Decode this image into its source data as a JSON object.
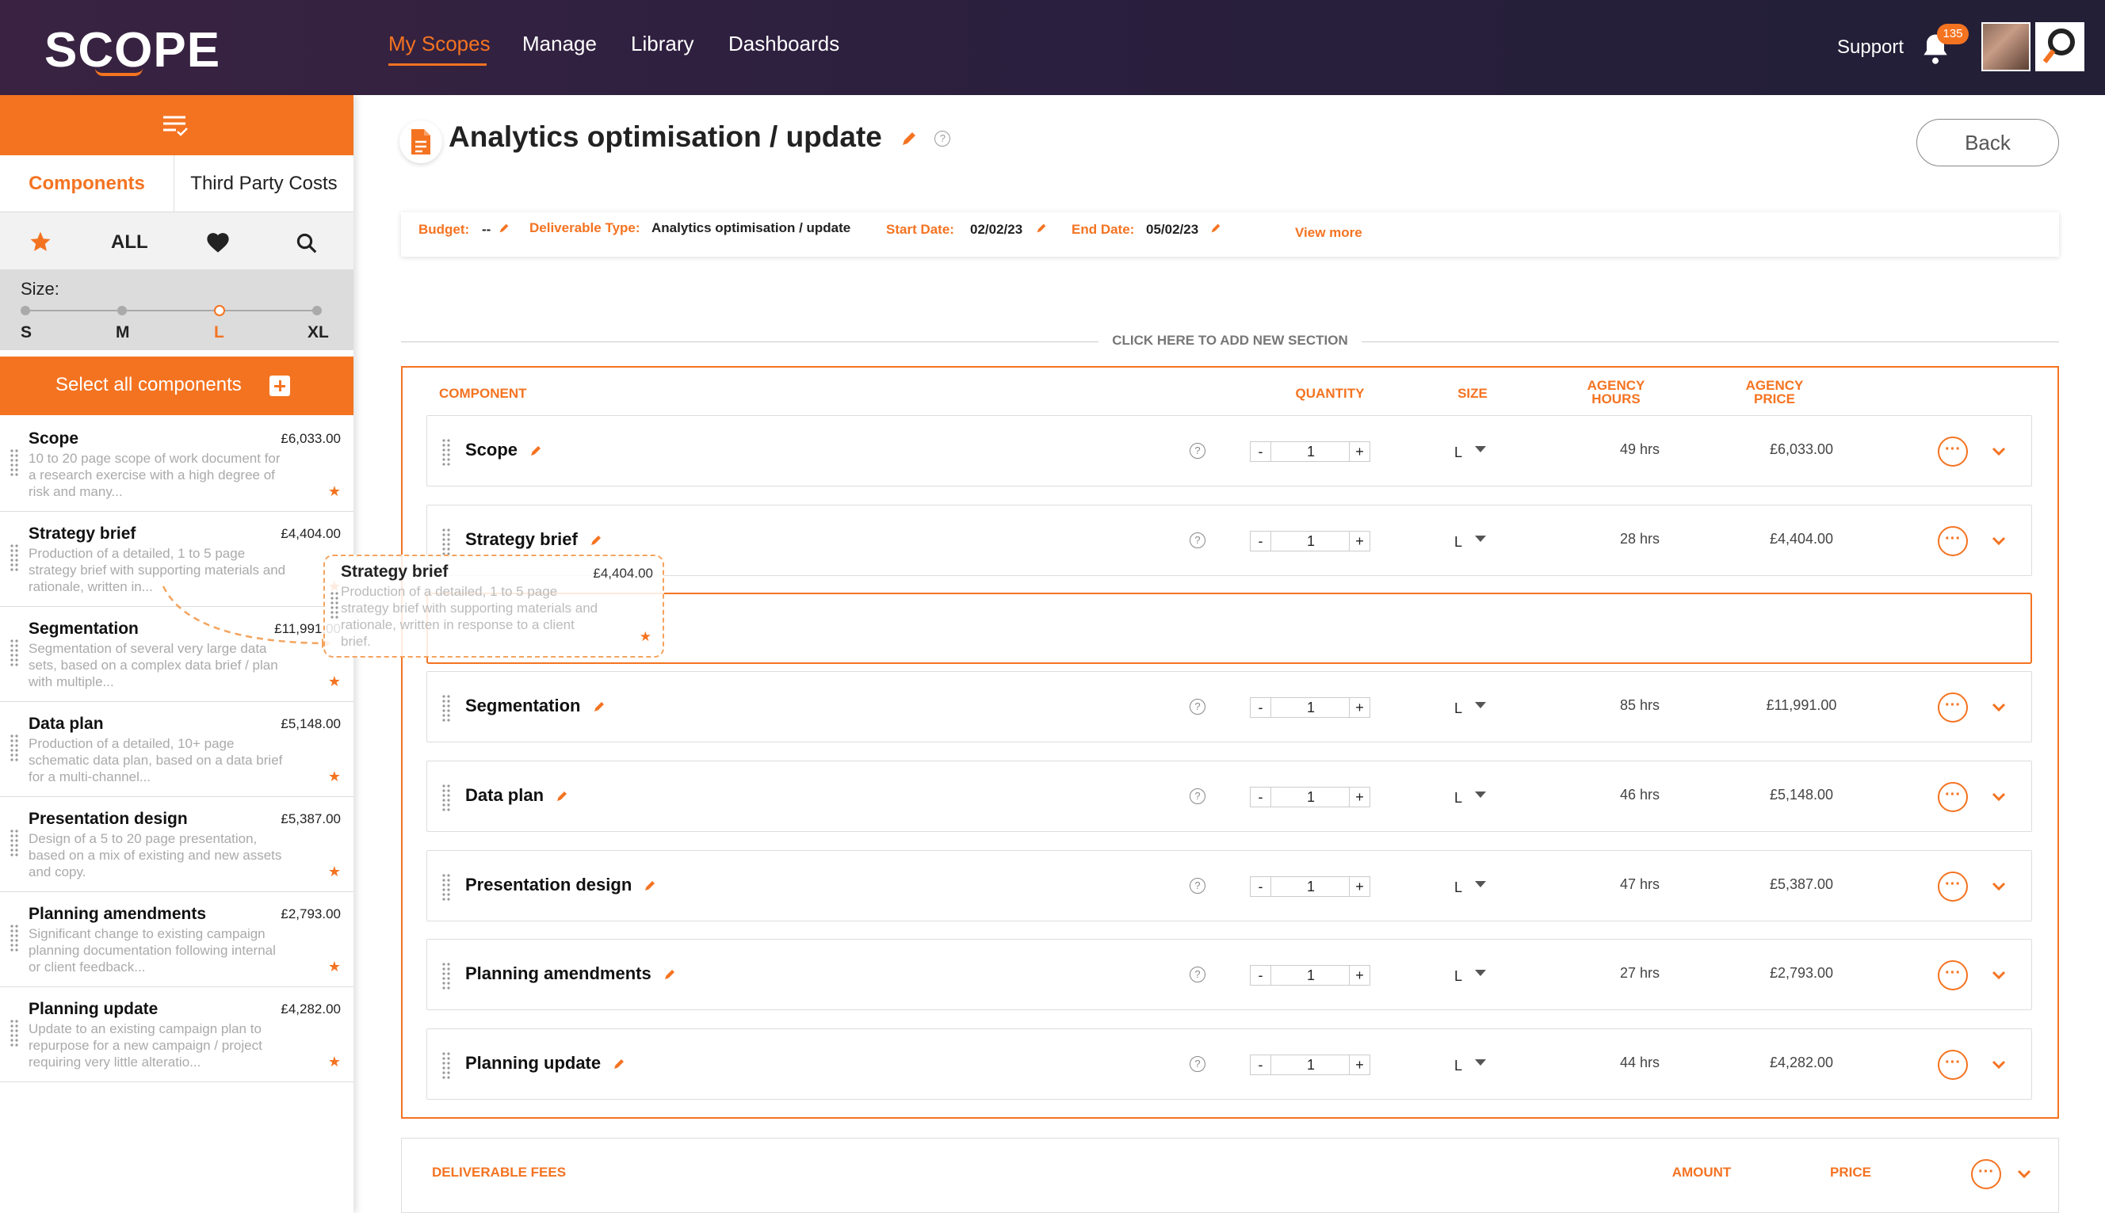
{
  "brand": {
    "logo_text": "SCOPE",
    "accent": "#f47321",
    "nav_bg": "#2a1f3e"
  },
  "nav": {
    "items": [
      "My Scopes",
      "Manage",
      "Library",
      "Dashboards"
    ],
    "active": "My Scopes",
    "support": "Support",
    "notification_count": "135"
  },
  "sidebar": {
    "tabs": [
      "Components",
      "Third Party Costs"
    ],
    "filter_all": "ALL",
    "size_label": "Size:",
    "sizes": [
      "S",
      "M",
      "L",
      "XL"
    ],
    "selected_size": "L",
    "select_all": "Select all components",
    "items": [
      {
        "title": "Scope",
        "price": "£6,033.00",
        "desc": "10 to 20 page scope of work document for a research exercise with a high degree of risk and many..."
      },
      {
        "title": "Strategy brief",
        "price": "£4,404.00",
        "desc": "Production of a detailed, 1 to 5 page strategy brief with supporting materials and rationale, written in..."
      },
      {
        "title": "Segmentation",
        "price": "£11,991.00",
        "desc": "Segmentation of several very large data sets, based on a complex data brief / plan with multiple..."
      },
      {
        "title": "Data plan",
        "price": "£5,148.00",
        "desc": "Production of a detailed, 10+ page schematic data plan, based on a data brief for a multi-channel..."
      },
      {
        "title": "Presentation design",
        "price": "£5,387.00",
        "desc": "Design of a 5 to 20 page presentation, based on a mix of existing and new assets and copy."
      },
      {
        "title": "Planning amendments",
        "price": "£2,793.00",
        "desc": "Significant change to existing campaign planning documentation following internal or client feedback..."
      },
      {
        "title": "Planning update",
        "price": "£4,282.00",
        "desc": "Update to an existing campaign plan to repurpose for a new campaign / project requiring very little alteratio..."
      }
    ]
  },
  "drag_ghost": {
    "title": "Strategy brief",
    "price": "£4,404.00",
    "desc": "Production of a detailed, 1 to 5 page strategy brief with supporting materials and rationale, written in response to a client brief."
  },
  "page": {
    "title": "Analytics optimisation / update",
    "back": "Back",
    "info": {
      "budget_label": "Budget:",
      "budget_value": "--",
      "deliverable_label": "Deliverable Type:",
      "deliverable_value": "Analytics optimisation / update",
      "start_label": "Start Date:",
      "start_value": "02/02/23",
      "end_label": "End Date:",
      "end_value": "05/02/23",
      "view_more": "View more"
    },
    "add_section": "CLICK HERE TO ADD NEW SECTION",
    "columns": {
      "component": "COMPONENT",
      "quantity": "QUANTITY",
      "size": "SIZE",
      "hours": "AGENCY HOURS",
      "price": "AGENCY PRICE"
    },
    "rows": [
      {
        "title": "Scope",
        "qty": "1",
        "size": "L",
        "hours": "49 hrs",
        "price": "£6,033.00"
      },
      {
        "title": "Strategy brief",
        "qty": "1",
        "size": "L",
        "hours": "28 hrs",
        "price": "£4,404.00"
      },
      {
        "title": "Segmentation",
        "qty": "1",
        "size": "L",
        "hours": "85 hrs",
        "price": "£11,991.00"
      },
      {
        "title": "Data plan",
        "qty": "1",
        "size": "L",
        "hours": "46 hrs",
        "price": "£5,148.00"
      },
      {
        "title": "Presentation design",
        "qty": "1",
        "size": "L",
        "hours": "47 hrs",
        "price": "£5,387.00"
      },
      {
        "title": "Planning amendments",
        "qty": "1",
        "size": "L",
        "hours": "27 hrs",
        "price": "£2,793.00"
      },
      {
        "title": "Planning update",
        "qty": "1",
        "size": "L",
        "hours": "44 hrs",
        "price": "£4,282.00"
      }
    ],
    "fees": {
      "label": "DELIVERABLE FEES",
      "amount": "AMOUNT",
      "price": "PRICE"
    }
  }
}
